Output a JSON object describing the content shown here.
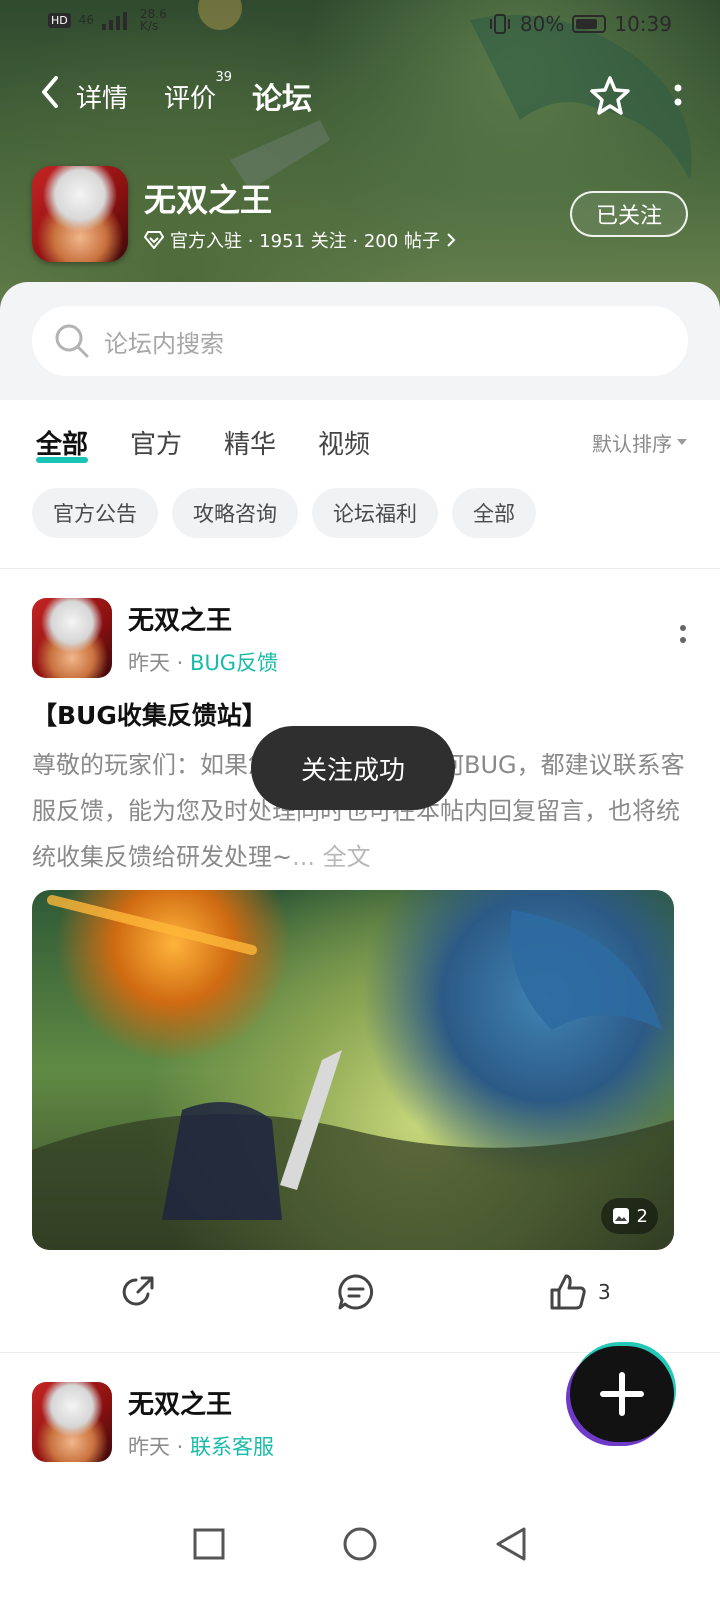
{
  "status_bar": {
    "hd": "HD",
    "signal": "46",
    "speed_value": "28.6",
    "speed_unit": "K/s",
    "battery": "80%",
    "battery_level": 0.8,
    "time": "10:39"
  },
  "top_nav": {
    "tabs": [
      {
        "label": "详情"
      },
      {
        "label": "评价",
        "badge": "39"
      },
      {
        "label": "论坛"
      }
    ]
  },
  "game": {
    "name": "无双之王",
    "sub": "官方入驻 · 1951 关注 · 200 帖子",
    "follow_label": "已关注"
  },
  "search": {
    "placeholder": "论坛内搜索"
  },
  "filters": {
    "tabs": [
      "全部",
      "官方",
      "精华",
      "视频"
    ],
    "sort": "默认排序",
    "chips": [
      "官方公告",
      "攻略咨询",
      "论坛福利",
      "全部"
    ]
  },
  "posts": [
    {
      "author": "无双之王",
      "time": "昨天",
      "tag": "BUG反馈",
      "title": "【BUG收集反馈站】",
      "body": "尊敬的玩家们：如果您在游戏中出现任何BUG，都建议联系客服反馈，能为您及时处理同时也可在本帖内回复留言，也将统统收集反馈给研发处理~",
      "more": "... 全文",
      "image_count": "2",
      "likes": "3"
    },
    {
      "author": "无双之王",
      "time": "昨天",
      "tag": "联系客服"
    }
  ],
  "toast": "关注成功"
}
